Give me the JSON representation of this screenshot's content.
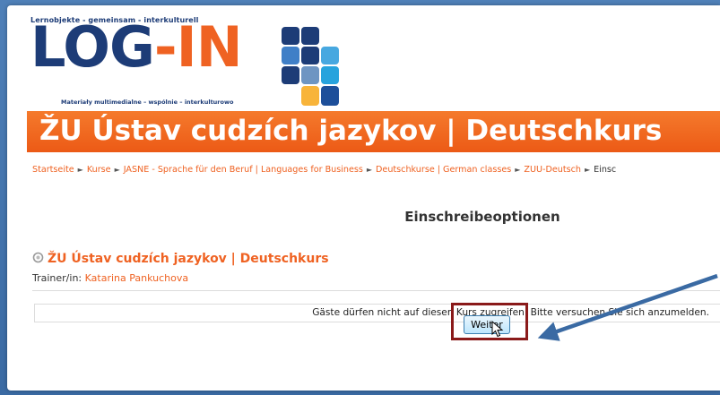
{
  "logo": {
    "tagline": "Lernobjekte - gemeinsam - interkulturell",
    "word_log": "LOG",
    "word_dash": "-",
    "word_in": "IN",
    "subtitle": "Materiały multimedialne – wspólnie – interkulturowo"
  },
  "banner": {
    "title": "ŽU Ústav cudzích jazykov | Deutschkurs"
  },
  "breadcrumb": {
    "items": [
      "Startseite",
      "Kurse",
      "JASNE - Sprache für den Beruf | Languages for Business",
      "Deutschkurse | German classes",
      "ZUU-Deutsch",
      "Einsc"
    ]
  },
  "main": {
    "heading": "Einschreibeoptionen",
    "course_title": "ŽU Ústav cudzích jazykov | Deutschkurs",
    "trainer_label": "Trainer/in:",
    "trainer_name": "Katarina Pankuchova",
    "notice": "Gäste dürfen nicht auf diesen Kurs zugreifen. Bitte versuchen Sie sich anzumelden.",
    "continue_button": "Weiter"
  },
  "colors": {
    "accent_orange": "#ef6222",
    "logo_navy": "#1d3c77",
    "highlight_border": "#8a1a1a",
    "arrow_blue": "#3a6aa3",
    "background_blue": "#4f80b8"
  },
  "icons": [
    "course-icon",
    "mouse-cursor-icon",
    "annotation-arrow-icon",
    "breadcrumb-separator-icon"
  ]
}
